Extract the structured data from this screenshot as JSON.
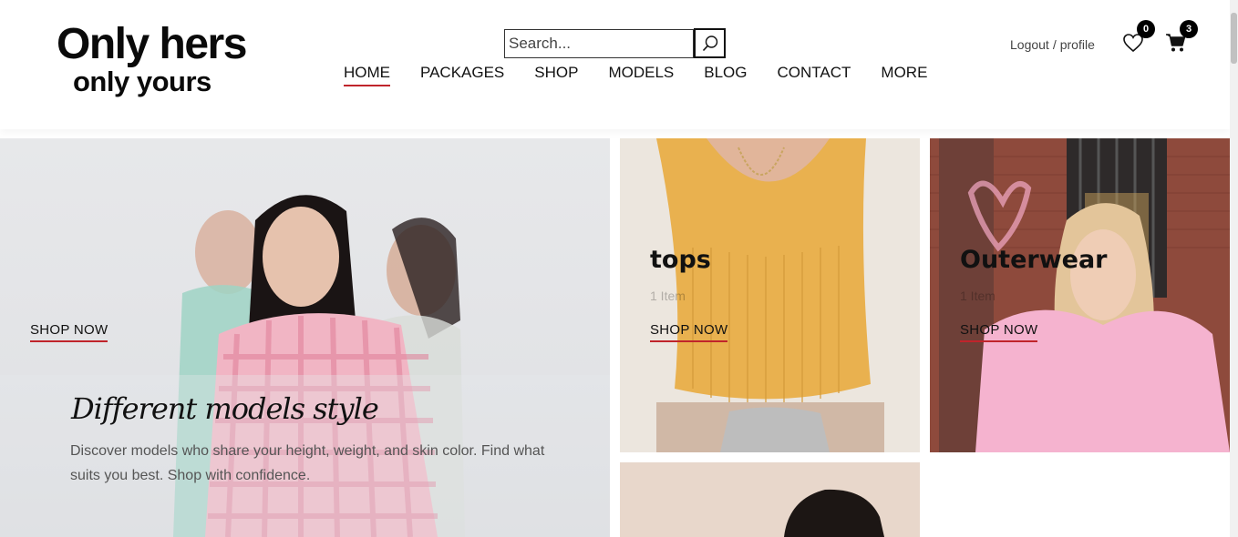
{
  "header": {
    "logo_line1": "Only hers",
    "logo_line2": "only yours",
    "search_placeholder": "Search...",
    "nav": [
      {
        "label": "HOME",
        "active": true
      },
      {
        "label": "PACKAGES"
      },
      {
        "label": "SHOP"
      },
      {
        "label": "MODELS"
      },
      {
        "label": "BLOG"
      },
      {
        "label": "CONTACT"
      },
      {
        "label": "MORE"
      }
    ],
    "logout_label": "Logout",
    "account_sep": "/",
    "profile_label": "profile",
    "wishlist_count": "0",
    "cart_count": "3",
    "accent_color": "#c0242b"
  },
  "hero": {
    "title": "Different models style",
    "description": "Discover models who share your height, weight, and skin color. Find what suits you best. Shop with confidence.",
    "cta": "SHOP NOW"
  },
  "tiles": [
    {
      "title": "tops",
      "subtitle": "1 Item",
      "cta": "SHOP NOW"
    },
    {
      "title": "Outerwear",
      "subtitle": "1 Item",
      "cta": "SHOP NOW"
    }
  ],
  "icons": {
    "search": "search-icon",
    "wishlist": "heart-icon",
    "cart": "cart-icon"
  }
}
